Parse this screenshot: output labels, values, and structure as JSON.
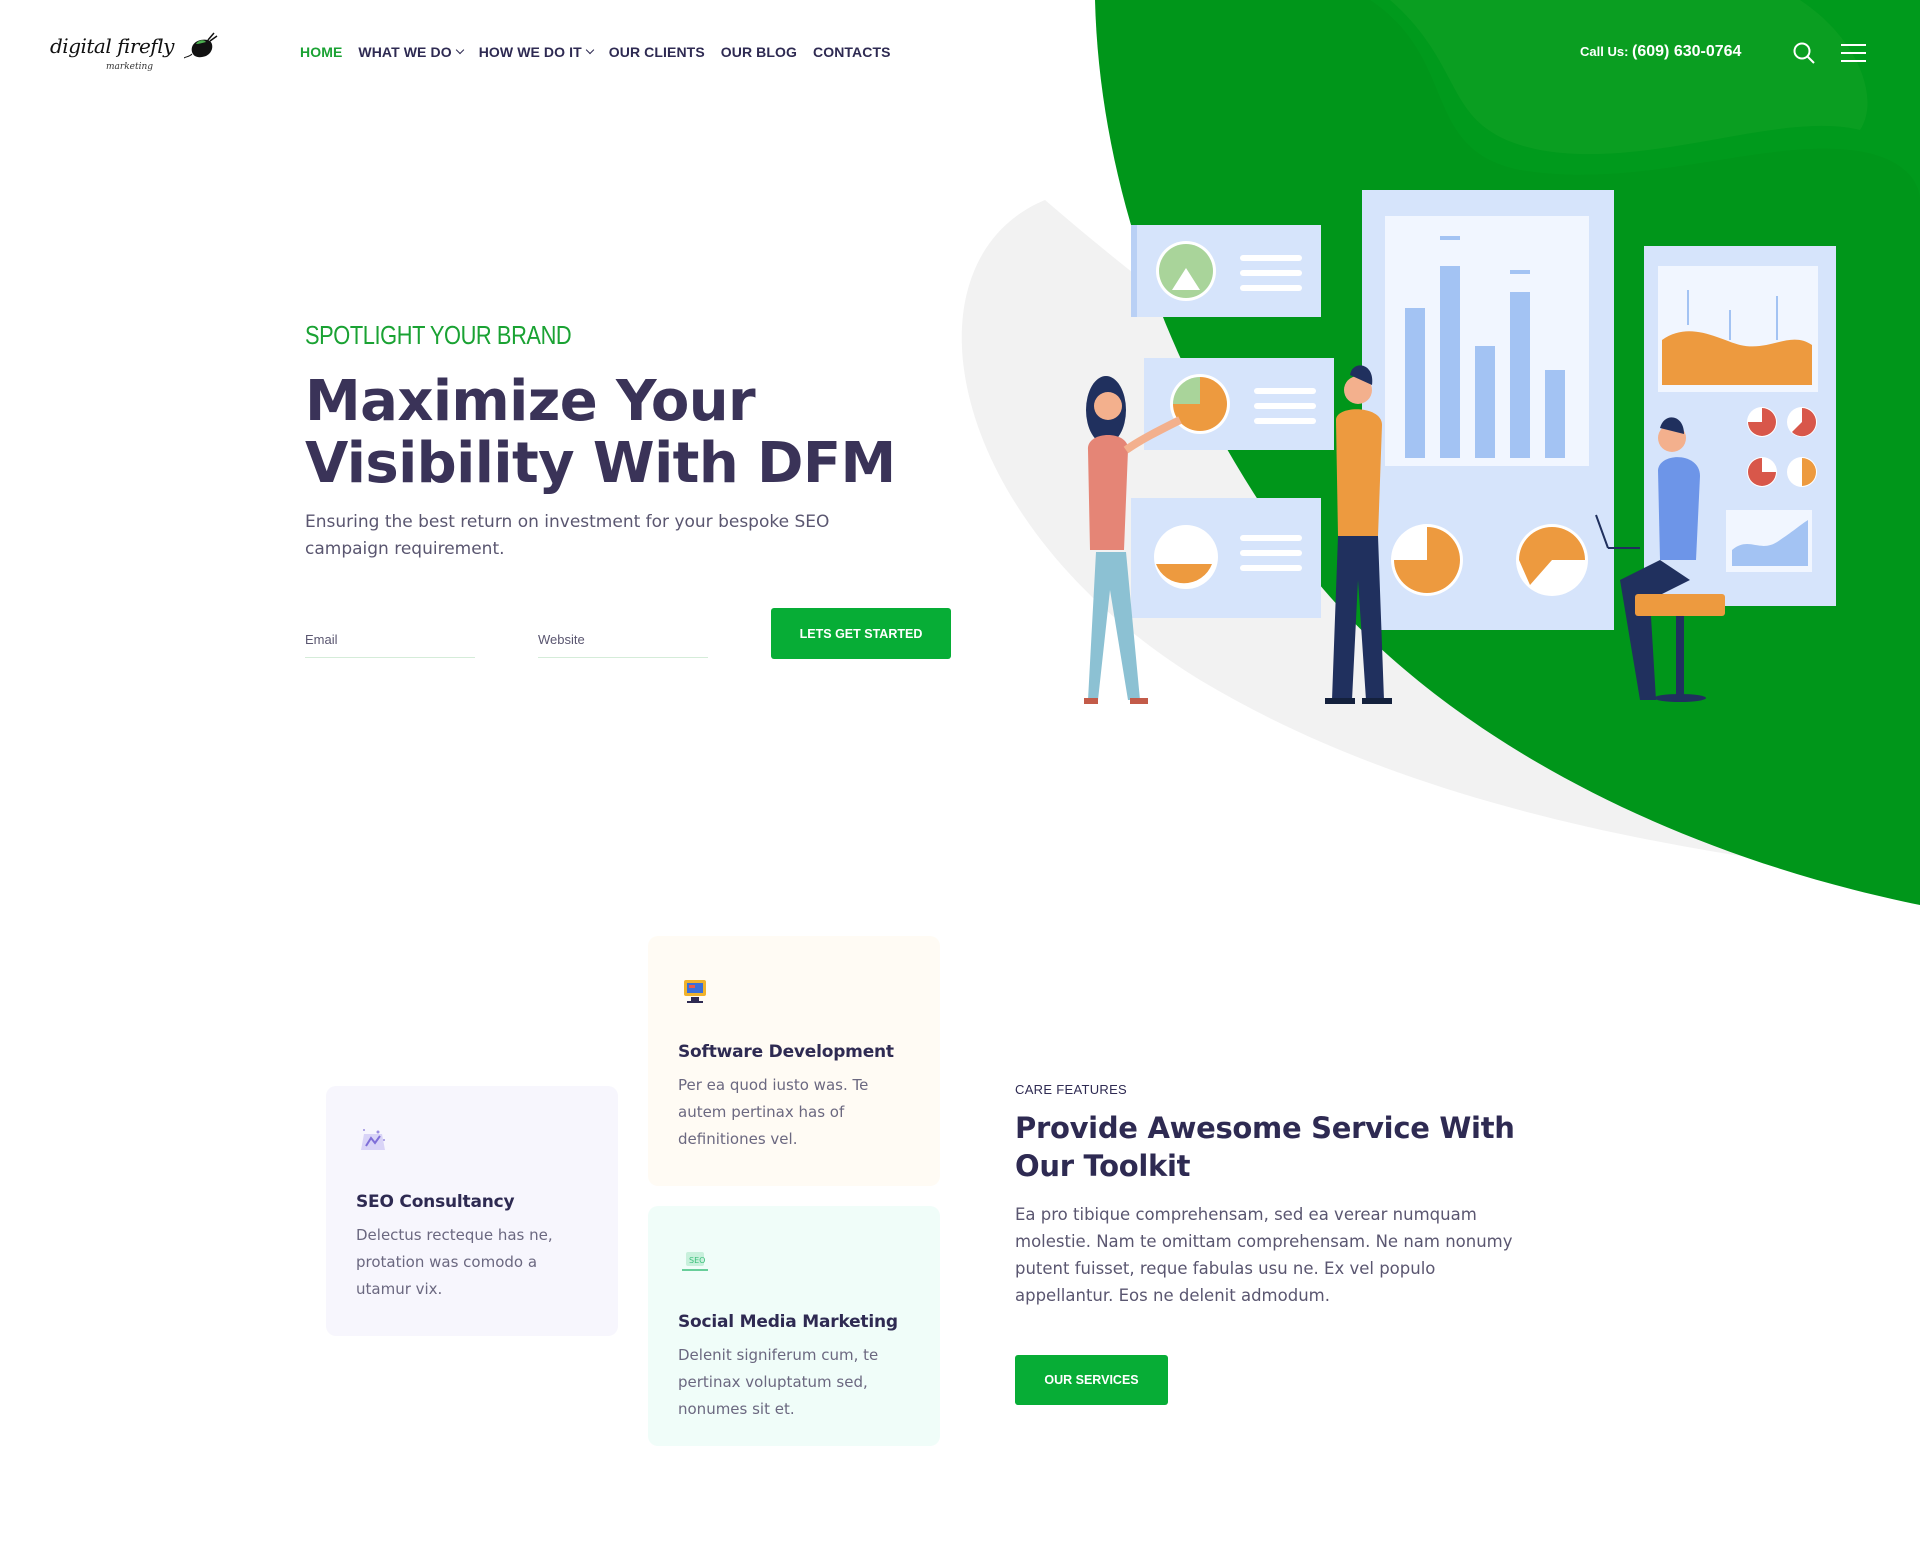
{
  "brand": {
    "logo_alt": "digital firefly marketing",
    "logo_text": "digital firefly",
    "logo_sub": "marketing"
  },
  "nav": {
    "items": [
      {
        "label": "HOME",
        "active": true,
        "dropdown": false
      },
      {
        "label": "WHAT WE DO",
        "active": false,
        "dropdown": true
      },
      {
        "label": "HOW WE DO IT",
        "active": false,
        "dropdown": true
      },
      {
        "label": "OUR CLIENTS",
        "active": false,
        "dropdown": false
      },
      {
        "label": "OUR BLOG",
        "active": false,
        "dropdown": false
      },
      {
        "label": "CONTACTS",
        "active": false,
        "dropdown": false
      }
    ],
    "call_label": "Call Us:",
    "phone": "(609) 630-0764"
  },
  "hero": {
    "eyebrow": "SPOTLIGHT YOUR BRAND",
    "title_line1": "Maximize Your",
    "title_line2": "Visibility With DFM",
    "subtitle": "Ensuring the best return on investment for your bespoke SEO campaign requirement.",
    "email_placeholder": "Email",
    "website_placeholder": "Website",
    "cta": "LETS GET STARTED"
  },
  "cards": [
    {
      "title": "SEO Consultancy",
      "text": "Delectus recteque has ne, protation was comodo a utamur vix.",
      "icon": "seo-icon"
    },
    {
      "title": "Software Development",
      "text": "Per ea quod iusto was. Te autem pertinax has of definitiones vel.",
      "icon": "monitor-icon"
    },
    {
      "title": "Social Media Marketing",
      "text": "Delenit signiferum cum, te pertinax voluptatum sed, nonumes sit et.",
      "icon": "social-icon"
    }
  ],
  "features": {
    "label": "CARE FEATURES",
    "title": "Provide Awesome Service With Our Toolkit",
    "text": "Ea pro tibique comprehensam, sed ea verear numquam molestie. Nam te omittam comprehensam. Ne nam nonumy putent fuisset, reque fabulas usu ne. Ex vel populo appellantur. Eos ne delenit admodum.",
    "cta": "OUR SERVICES"
  },
  "colors": {
    "accent_green": "#07ad36",
    "hero_green": "#00961a",
    "heading": "#3a3358"
  }
}
